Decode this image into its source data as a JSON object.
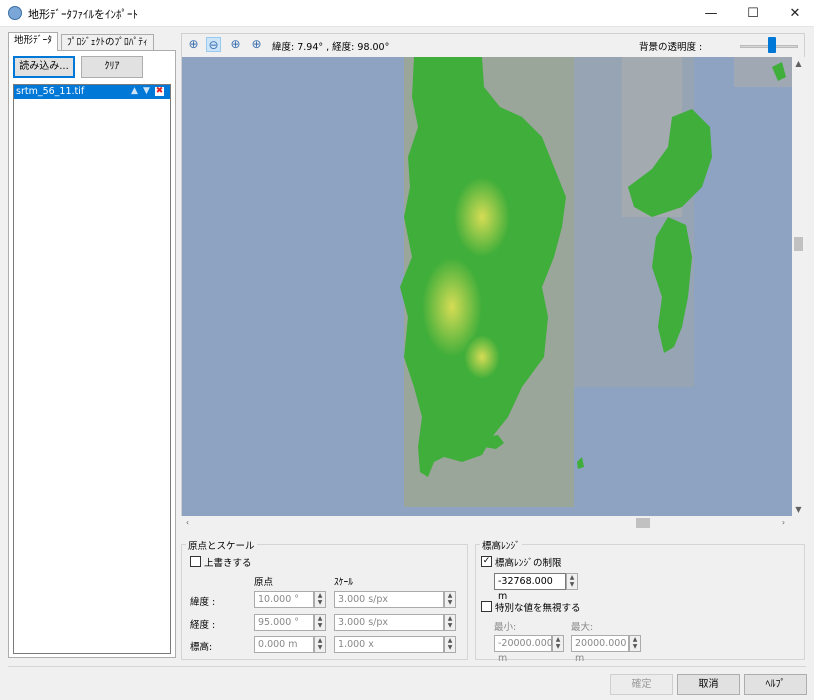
{
  "window": {
    "title": "地形ﾃﾞｰﾀﾌｧｲﾙをｲﾝﾎﾟｰﾄ",
    "minimize": "—",
    "maximize": "☐",
    "close": "✕"
  },
  "tabs": [
    "地形ﾃﾞｰﾀ",
    "ﾌﾟﾛｼﾞｪｸﾄのﾌﾟﾛﾊﾟﾃｨ"
  ],
  "left": {
    "load_button": "読み込み...",
    "clear_button": "ｸﾘｱ",
    "files": [
      {
        "name": "srtm_56_11.tif"
      }
    ],
    "file_actions": {
      "up": "▲",
      "down": "▼",
      "remove": "✖"
    }
  },
  "toolbar": {
    "zoom_icons": [
      "⊕",
      "⊖",
      "⊕",
      "⊕"
    ],
    "coords": "緯度: 7.94° , 経度: 98.00°",
    "opacity_label": "背景の透明度 :",
    "opacity_level": 0.55
  },
  "scroll": {
    "up": "▲",
    "down": "▼",
    "left": "‹",
    "right": "›"
  },
  "origin_scale": {
    "group_label": "原点とスケール",
    "overwrite_label": "上書きする",
    "overwrite_checked": false,
    "col_origin": "原点",
    "col_scale": "ｽｹｰﾙ",
    "rows": [
      {
        "label": "緯度 :",
        "origin": "10.000 °",
        "scale": "3.000 s/px"
      },
      {
        "label": "経度 :",
        "origin": "95.000 °",
        "scale": "3.000 s/px"
      },
      {
        "label": "標高:",
        "origin": "0.000 m",
        "scale": "1.000 x"
      }
    ]
  },
  "elev_range": {
    "group_label": "標高ﾚﾝｼﾞ",
    "limit_label": "標高ﾚﾝｼﾞの制限",
    "limit_checked": true,
    "limit_value": "-32768.000 m",
    "ignore_label": "特別な値を無視する",
    "ignore_checked": false,
    "min_label": "最小:",
    "max_label": "最大:",
    "min_value": "-20000.000 m",
    "max_value": "20000.000 m"
  },
  "footer": {
    "ok": "確定",
    "cancel": "取消",
    "help": "ﾍﾙﾌﾟ"
  },
  "colors": {
    "accent": "#0078d7",
    "sea": "#8ea3c1",
    "land_low": "#3fae3a",
    "land_high": "#c9d84a"
  }
}
